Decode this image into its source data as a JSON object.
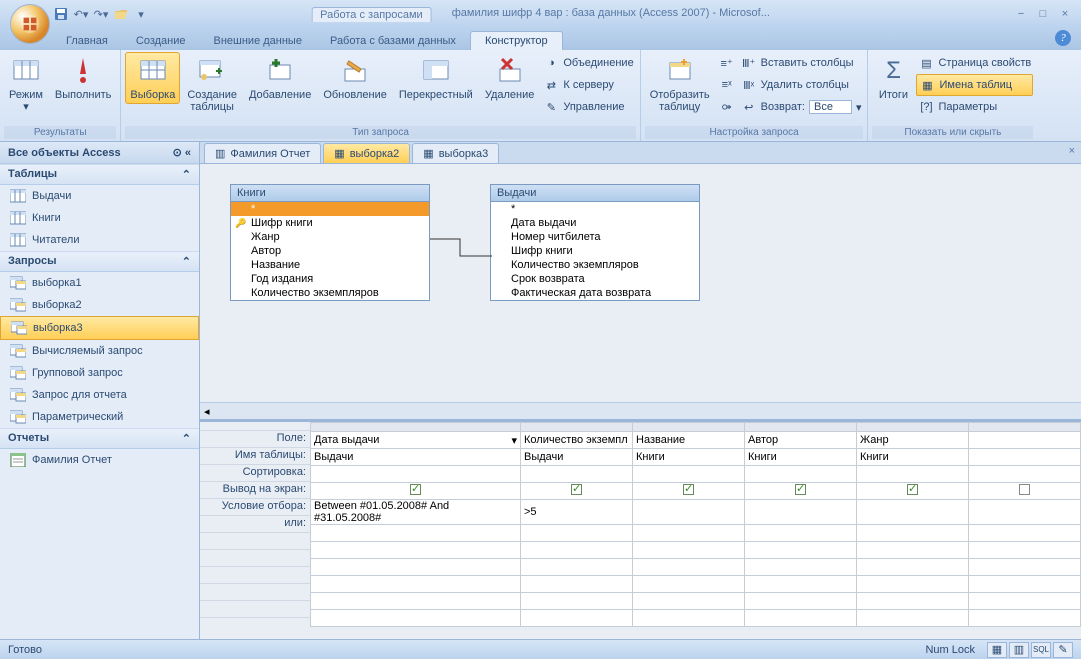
{
  "titlebar": {
    "context_title": "Работа с запросами",
    "app_title": "фамилия шифр 4 вар : база данных (Access 2007) - Microsof..."
  },
  "tabs": {
    "home": "Главная",
    "create": "Создание",
    "external": "Внешние данные",
    "dbtools": "Работа с базами данных",
    "designer": "Конструктор"
  },
  "ribbon": {
    "results": {
      "mode": "Режим",
      "run": "Выполнить",
      "label": "Результаты"
    },
    "qtype": {
      "select": "Выборка",
      "maketable": "Создание\nтаблицы",
      "append": "Добавление",
      "update": "Обновление",
      "crosstab": "Перекрестный",
      "delete": "Удаление",
      "union": "Объединение",
      "passthrough": "К серверу",
      "datadef": "Управление",
      "label": "Тип запроса"
    },
    "setup": {
      "show": "Отобразить\nтаблицу",
      "inscol": "Вставить столбцы",
      "delcol": "Удалить столбцы",
      "return_lbl": "Возврат:",
      "return_val": "Все",
      "label": "Настройка запроса"
    },
    "showhide": {
      "totals": "Итоги",
      "propsheet": "Страница свойств",
      "tablenames": "Имена таблиц",
      "params": "Параметры",
      "label": "Показать или скрыть"
    }
  },
  "nav": {
    "header": "Все объекты Access",
    "sec_tables": "Таблицы",
    "tables": [
      "Выдачи",
      "Книги",
      "Читатели"
    ],
    "sec_queries": "Запросы",
    "queries": [
      "выборка1",
      "выборка2",
      "выборка3",
      "Вычисляемый запрос",
      "Групповой запрос",
      "Запрос для отчета",
      "Параметрический"
    ],
    "sec_reports": "Отчеты",
    "reports": [
      "Фамилия Отчет"
    ]
  },
  "doctabs": {
    "t1": "Фамилия Отчет",
    "t2": "выборка2",
    "t3": "выборка3"
  },
  "design": {
    "box1": {
      "title": "Книги",
      "rows": [
        "*",
        "Шифр книги",
        "Жанр",
        "Автор",
        "Название",
        "Год издания",
        "Количество экземпляров"
      ]
    },
    "box2": {
      "title": "Выдачи",
      "rows": [
        "*",
        "Дата выдачи",
        "Номер читбилета",
        "Шифр книги",
        "Количество экземпляров",
        "Срок возврата",
        "Фактическая дата возврата"
      ]
    }
  },
  "grid": {
    "labels": {
      "field": "Поле:",
      "table": "Имя таблицы:",
      "sort": "Сортировка:",
      "show": "Вывод на экран:",
      "criteria": "Условие отбора:",
      "or": "или:"
    },
    "cols": [
      {
        "field": "Дата выдачи",
        "table": "Выдачи",
        "show": true,
        "criteria": "Between #01.05.2008# And #31.05.2008#"
      },
      {
        "field": "Количество экземпл",
        "table": "Выдачи",
        "show": true,
        "criteria": ">5"
      },
      {
        "field": "Название",
        "table": "Книги",
        "show": true,
        "criteria": ""
      },
      {
        "field": "Автор",
        "table": "Книги",
        "show": true,
        "criteria": ""
      },
      {
        "field": "Жанр",
        "table": "Книги",
        "show": true,
        "criteria": ""
      }
    ]
  },
  "status": {
    "ready": "Готово",
    "numlock": "Num Lock"
  }
}
